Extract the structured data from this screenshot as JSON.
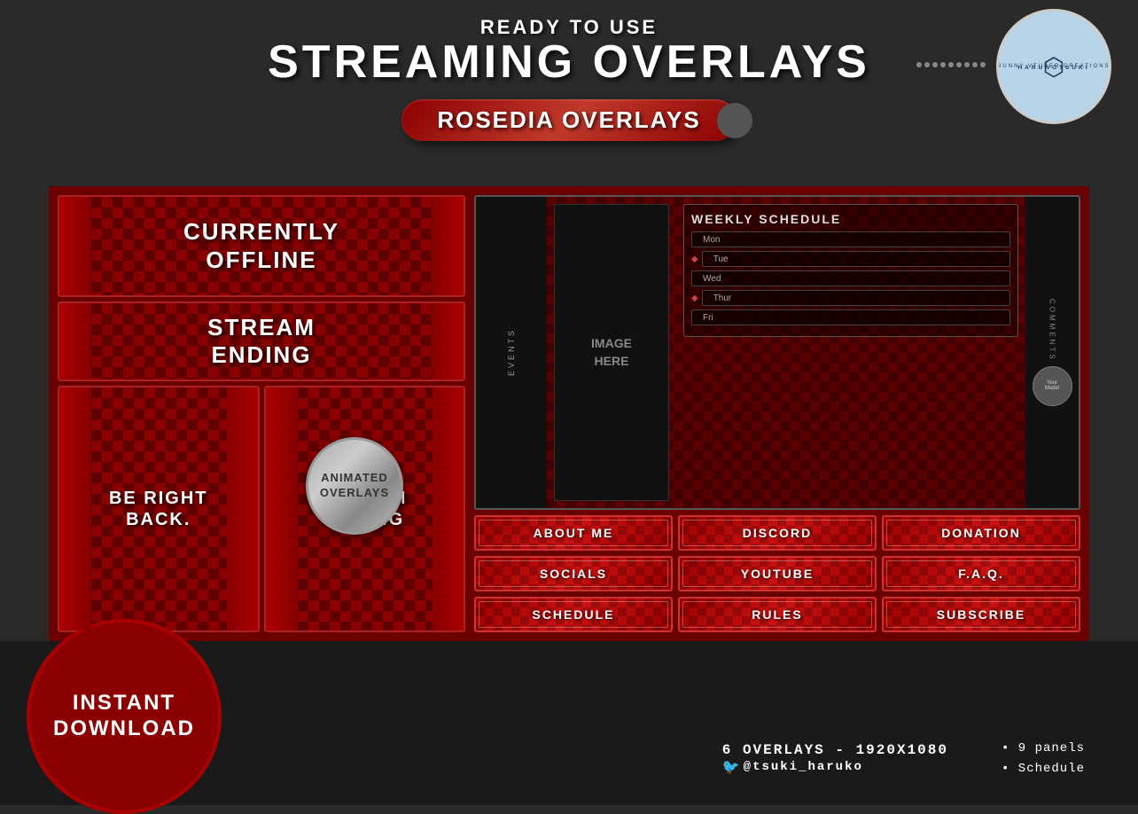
{
  "header": {
    "ready_label": "READY TO USE",
    "streaming_label": "STREAMING OVERLAYS",
    "brand_label": "ROSEDIA OVERLAYS",
    "logo_brand": "HARUNOTSUKI",
    "logo_sub": "Bunny Vtuber Creations"
  },
  "left_panels": {
    "panel1": "CURRENTLY\nOFFLINE",
    "panel2": "STREAM\nENDING",
    "panel3": "BE RIGHT\nBACK.",
    "panel4": "STREAM\nENDING"
  },
  "animated_badge": {
    "line1": "ANIMATED",
    "line2": "OVERLAYS"
  },
  "overlay": {
    "left_label": "EVENTS",
    "right_label": "COMMENTS",
    "image_placeholder": "IMAGE\nHERE",
    "schedule_title": "WEEKLY SCHEDULE",
    "days": [
      "Mon",
      "Tue",
      "Wed",
      "Thur",
      "Fri"
    ],
    "model_label": "Your\nModel"
  },
  "panels": [
    "ABOUT ME",
    "DISCORD",
    "DONATION",
    "SOCIALS",
    "YOUTUBE",
    "F.A.Q.",
    "SCHEDULE",
    "RULES",
    "SUBSCRIBE"
  ],
  "bottom": {
    "instant": "INSTANT\nDOWNLOAD",
    "spec": "6 OVERLAYS - 1920X1080",
    "twitter": "@tsuki_haruko",
    "panels_count": "• 9 panels",
    "schedule": "• Schedule"
  }
}
